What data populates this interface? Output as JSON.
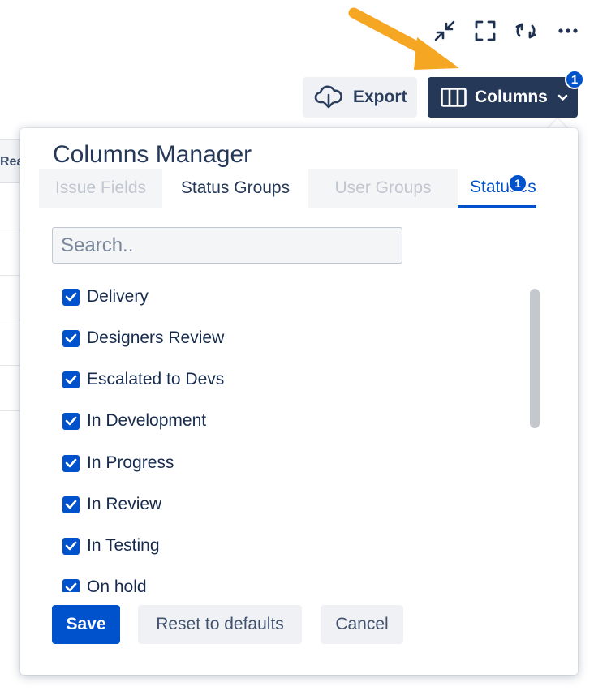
{
  "toolbar": {
    "icons": [
      "compress-icon",
      "fullscreen-icon",
      "refresh-icon",
      "more-icon"
    ],
    "export_label": "Export",
    "columns_label": "Columns",
    "columns_badge": "1"
  },
  "background_table": {
    "header_fragment": "Rea"
  },
  "columns_manager": {
    "title": "Columns Manager",
    "tabs": [
      {
        "label": "Issue Fields",
        "state": "disabled"
      },
      {
        "label": "Status Groups",
        "state": "normal"
      },
      {
        "label": "User Groups",
        "state": "disabled"
      },
      {
        "label": "Statuses",
        "state": "active",
        "badge": "1"
      }
    ],
    "search": {
      "placeholder": "Search..",
      "value": ""
    },
    "statuses": [
      {
        "label": "Delivery",
        "checked": true
      },
      {
        "label": "Designers Review",
        "checked": true
      },
      {
        "label": "Escalated to Devs",
        "checked": true
      },
      {
        "label": "In Development",
        "checked": true
      },
      {
        "label": "In Progress",
        "checked": true
      },
      {
        "label": "In Review",
        "checked": true
      },
      {
        "label": "In Testing",
        "checked": true
      },
      {
        "label": "On hold",
        "checked": true
      }
    ],
    "buttons": {
      "save": "Save",
      "reset": "Reset to defaults",
      "cancel": "Cancel"
    }
  },
  "colors": {
    "primary": "#0052cc",
    "columns_button": "#253858",
    "annotation_arrow": "#f5a623"
  }
}
